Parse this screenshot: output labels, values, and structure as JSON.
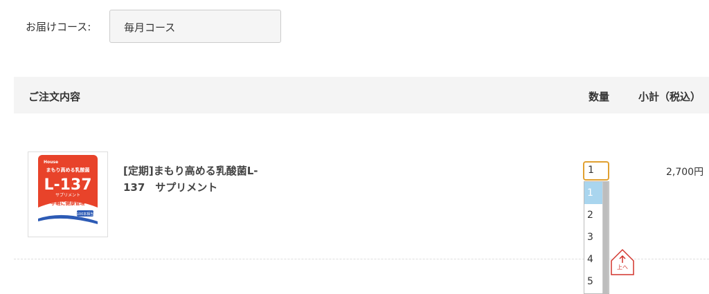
{
  "course": {
    "label": "お届けコース:",
    "value": "毎月コース"
  },
  "table_header": {
    "order": "ご注文内容",
    "quantity": "数量",
    "subtotal": "小計（税込）"
  },
  "item": {
    "image_alt": "まもり高める乳酸菌 L-137 サプリメント",
    "name_line1": "[定期]まもり高める乳酸菌L-",
    "name_line2": "137　サプリメント",
    "quantity": "1",
    "subtotal": "2,700円"
  },
  "quantity_options": [
    "1",
    "2",
    "3",
    "4",
    "5"
  ],
  "selected_quantity_index": 0,
  "back_to_top": {
    "label": "上へ"
  },
  "colors": {
    "accent_orange": "#e0a030",
    "selected_option": "#a9d5ee",
    "brand_red": "#e8432a"
  },
  "image_text": {
    "brand": "House",
    "package_subtitle": "まもり高める乳酸菌",
    "package_title": "L-137",
    "package_type": "サプリメント",
    "package_tagline": "手軽に健康管理",
    "package_badge": "100本相当"
  }
}
